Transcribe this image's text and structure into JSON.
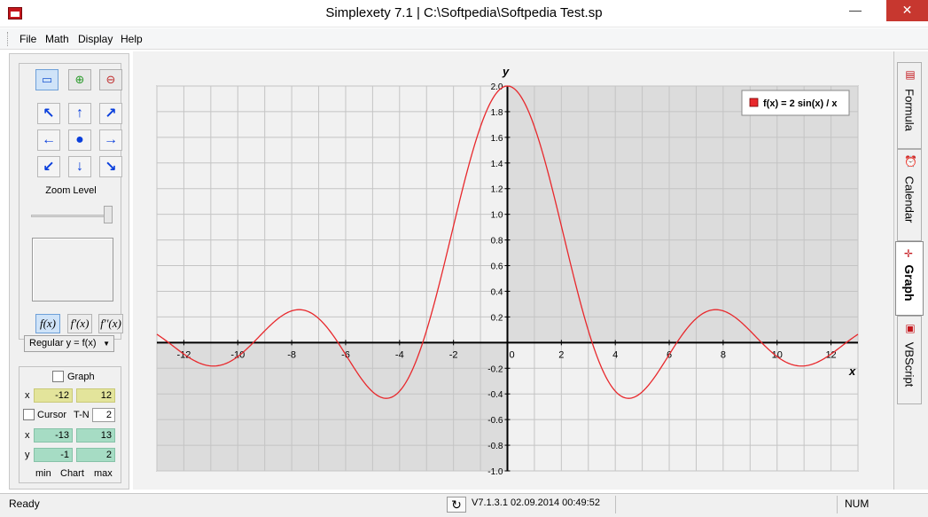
{
  "window": {
    "title": "Simplexety 7.1 | C:\\Softpedia\\Softpedia Test.sp",
    "min_label": "—",
    "max_label": "☐",
    "close_label": "✕"
  },
  "menu": [
    {
      "label": "File"
    },
    {
      "label": "Math"
    },
    {
      "label": "Display"
    },
    {
      "label": "Help"
    }
  ],
  "navigation": {
    "zoom_label": "Zoom Level",
    "zoom_level": 1.0,
    "fx_buttons": [
      "f(x)",
      "f'(x)",
      "f''(x)"
    ],
    "mode_select": "Regular y = f(x)"
  },
  "chart_panel": {
    "graph_label": "Graph",
    "cursor_label": "Cursor",
    "tn_label": "T-N",
    "tn_value": "2",
    "x_label": "x",
    "y_label": "y",
    "cursor_x_min": "-12",
    "cursor_x_max": "12",
    "chart_x_min": "-13",
    "chart_x_max": "13",
    "chart_y_min": "-1",
    "chart_y_max": "2",
    "min_label": "min",
    "chart_label": "Chart",
    "max_label": "max"
  },
  "chart_data": {
    "type": "line",
    "function": "2*sin(x)/x",
    "legend": "f(x) = 2  sin(x) / x",
    "xlabel": "x",
    "ylabel": "y",
    "xlim": [
      -13,
      13
    ],
    "ylim": [
      -1,
      2
    ],
    "x_ticks": [
      -12,
      -10,
      -8,
      -6,
      -4,
      -2,
      0,
      2,
      4,
      6,
      8,
      10,
      12
    ],
    "y_ticks": [
      "-1.0",
      "-0.8",
      "-0.6",
      "-0.4",
      "-0.2",
      "0.2",
      "0.4",
      "0.6",
      "0.8",
      "1.0",
      "1.2",
      "1.4",
      "1.6",
      "1.8",
      "2.0"
    ],
    "legend_position": "top-right",
    "grid": true,
    "series_color": "#e8282c"
  },
  "right_tabs": [
    {
      "label": "Formula"
    },
    {
      "label": "Calendar"
    },
    {
      "label": "Graph"
    },
    {
      "label": "VBScript"
    }
  ],
  "status": {
    "text": "Ready",
    "version": "V7.1.3.1  02.09.2014 00:49:52",
    "num": "NUM"
  }
}
